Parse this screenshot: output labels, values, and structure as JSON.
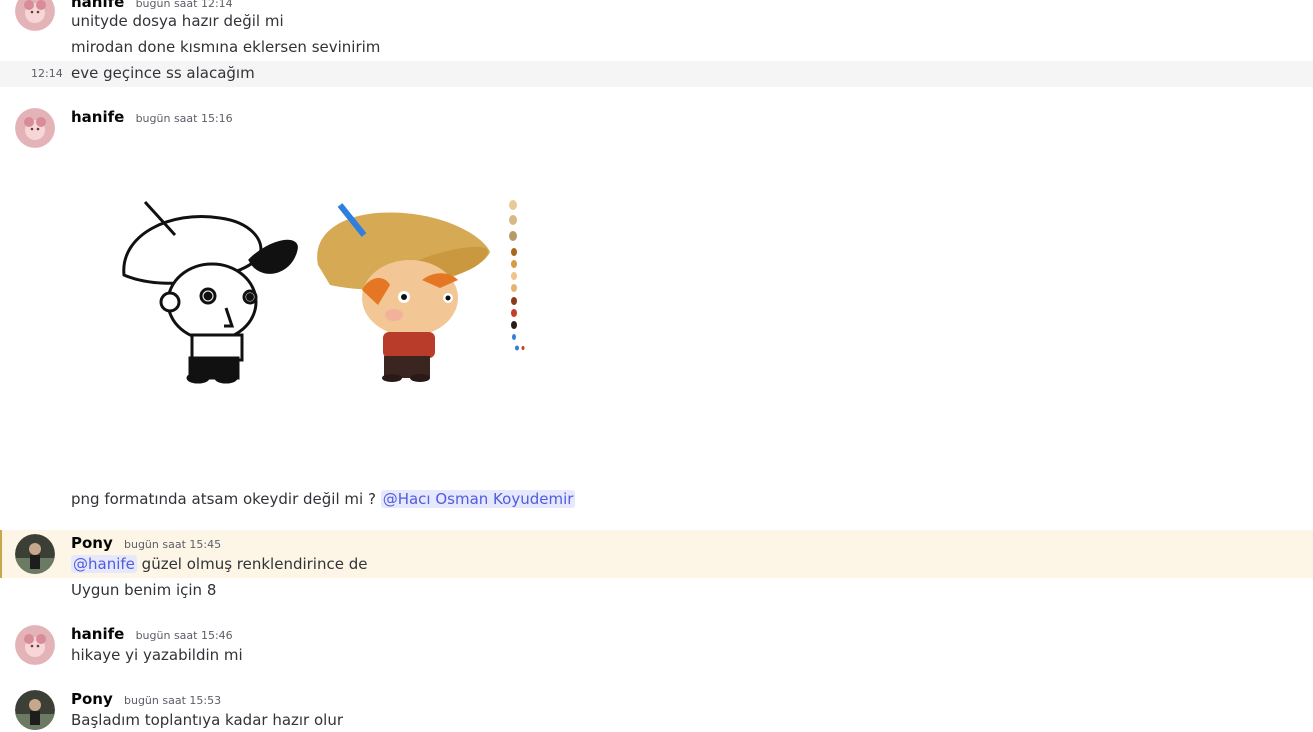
{
  "messages": {
    "m1": {
      "username": "hanife",
      "timestamp": "bugün saat 12:14",
      "lines": [
        "unityde dosya hazır değil mi",
        "mirodan done kısmına eklersen sevinirim"
      ],
      "followup_time": "12:14",
      "followup_text": "eve geçince ss alacağım"
    },
    "m2": {
      "username": "hanife",
      "timestamp": "bugün saat 15:16",
      "text": "png formatında atsam okeydir değil mi ?",
      "mention": "@Hacı Osman Koyudemir"
    },
    "m3": {
      "username": "Pony",
      "timestamp": "bugün saat 15:45",
      "mention": "@hanife",
      "text": "güzel olmuş renklendirince de",
      "line2": "Uygun benim için 8"
    },
    "m4": {
      "username": "hanife",
      "timestamp": "bugün saat 15:46",
      "text": "hikaye yi yazabildin mi"
    },
    "m5": {
      "username": "Pony",
      "timestamp": "bugün saat 15:53",
      "text": "Başladım toplantıya kadar hazır olur"
    }
  },
  "colors": {
    "mention_bg": "#e6e8fd",
    "mention_fg": "#505cdc",
    "highlight_bg": "#fdf6e7"
  },
  "icons": [
    "hanife-avatar",
    "pony-avatar"
  ]
}
